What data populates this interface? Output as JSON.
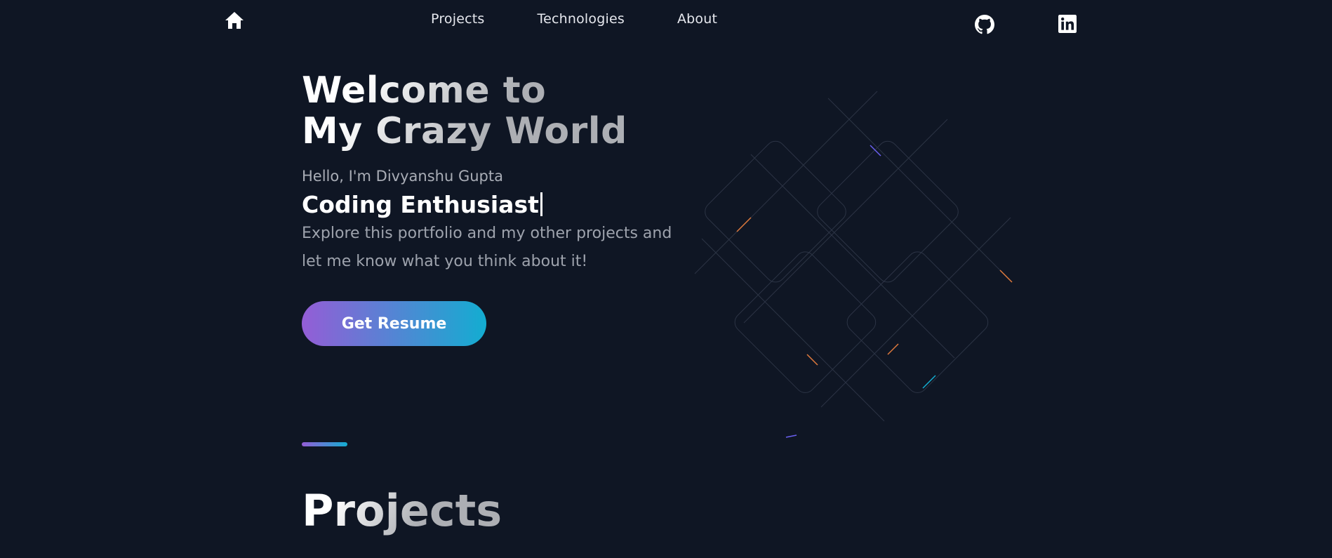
{
  "nav": {
    "links": [
      {
        "label": "Projects"
      },
      {
        "label": "Technologies"
      },
      {
        "label": "About"
      }
    ],
    "icons": {
      "home": "home-icon",
      "github": "github-icon",
      "linkedin": "linkedin-icon"
    }
  },
  "hero": {
    "title_line1": "Welcome to",
    "title_line2": "My Crazy World",
    "greeting": "Hello, I'm Divyanshu Gupta",
    "role": "Coding Enthusiast",
    "intro": "Explore this portfolio and my other projects and let me know what you think about it!",
    "button_label": "Get Resume"
  },
  "projects": {
    "title": "Projects"
  },
  "colors": {
    "background": "#0f1624",
    "gradient_start": "#945dd6",
    "gradient_end": "#13add1",
    "text_primary": "#ffffff",
    "text_muted": "#9ea3ad"
  }
}
